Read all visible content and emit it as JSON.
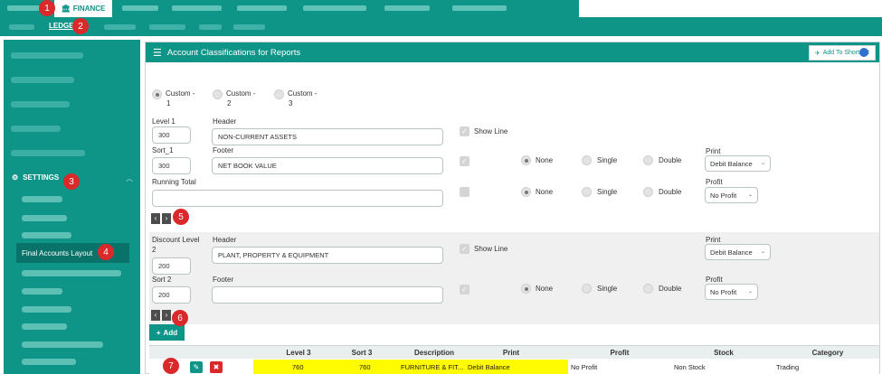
{
  "top": {
    "finance_tab": "FINANCE",
    "ledger_link": "LEDGER"
  },
  "sidebar": {
    "settings_label": "SETTINGS",
    "selected_item": "Final Accounts Layout"
  },
  "panel": {
    "title": "Account Classifications for Reports",
    "shortcut_button": "Add To ShortCut"
  },
  "custom_radios": [
    {
      "label": "Custom -",
      "sub": "1",
      "selected": true
    },
    {
      "label": "Custom -",
      "sub": "2",
      "selected": false
    },
    {
      "label": "Custom -",
      "sub": "3",
      "selected": false
    }
  ],
  "level1": {
    "level_label": "Level 1",
    "level_value": "300",
    "header_label": "Header",
    "header_value": "NON-CURRENT ASSETS",
    "sort_label": "Sort_1",
    "sort_value": "300",
    "footer_label": "Footer",
    "footer_value": "NET BOOK VALUE",
    "running_total_label": "Running Total",
    "show_line_label": "Show Line",
    "line_options": [
      "None",
      "Single",
      "Double"
    ],
    "print_label": "Print",
    "print_value": "Debit Balance",
    "profit_label": "Profit",
    "profit_value": "No Profit"
  },
  "discount": {
    "level_label": "Discount Level",
    "level_sub": "2",
    "level_value": "200",
    "header_label": "Header",
    "header_value": "PLANT, PROPERTY & EQUIPMENT",
    "sort_label": "Sort 2",
    "sort_value": "200",
    "footer_label": "Footer",
    "footer_value": "",
    "show_line_label": "Show Line",
    "line_options": [
      "None",
      "Single",
      "Double"
    ],
    "print_label": "Print",
    "print_value": "Debit Balance",
    "profit_label": "Profit",
    "profit_value": "No Profit"
  },
  "add_button": "Add",
  "table": {
    "headers": [
      "Level 3",
      "Sort 3",
      "Description",
      "Print",
      "Profit",
      "Stock",
      "Category"
    ],
    "row": [
      "760",
      "760",
      "FURNITURE & FIT...",
      "Debit Balance",
      "No Profit",
      "Non Stock",
      "Trading"
    ]
  },
  "badges": [
    "1",
    "2",
    "3",
    "4",
    "5",
    "6",
    "7"
  ],
  "colors": {
    "teal": "#0f9488",
    "badge": "#d9292b",
    "highlight": "#fffb00"
  }
}
